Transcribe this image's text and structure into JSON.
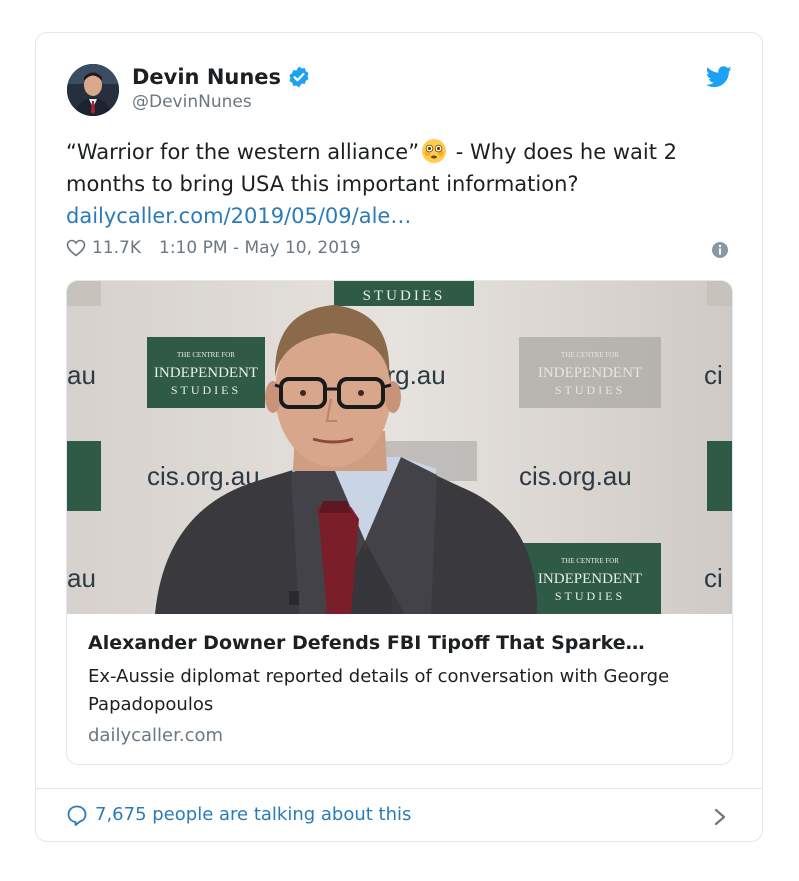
{
  "author": {
    "name": "Devin Nunes",
    "handle": "@DevinNunes",
    "verified": true
  },
  "tweet": {
    "text_before_emoji": "“Warrior for the western alliance”",
    "emoji": "flushed-face",
    "text_after_emoji": " - Why does he wait 2 months to bring USA this important information?",
    "link": "dailycaller.com/2019/05/09/ale…"
  },
  "meta": {
    "likes": "11.7K",
    "timestamp": "1:10 PM - May 10, 2019"
  },
  "card": {
    "title": "Alexander Downer Defends FBI Tipoff That Sparke…",
    "description": "Ex-Aussie diplomat reported details of conversation with George Papadopoulos",
    "domain": "dailycaller.com",
    "image_text": {
      "banner": "STUDIES",
      "logo_line1": "THE CENTRE FOR",
      "logo_line2": "INDEPENDENT",
      "logo_line3": "STUDIES",
      "web": "cis.org.au"
    }
  },
  "footer": {
    "talking": "7,675 people are talking about this"
  },
  "colors": {
    "link": "#2b7bb9",
    "muted": "#697882",
    "border": "#e1e8ed",
    "verified": "#1da1f2"
  }
}
